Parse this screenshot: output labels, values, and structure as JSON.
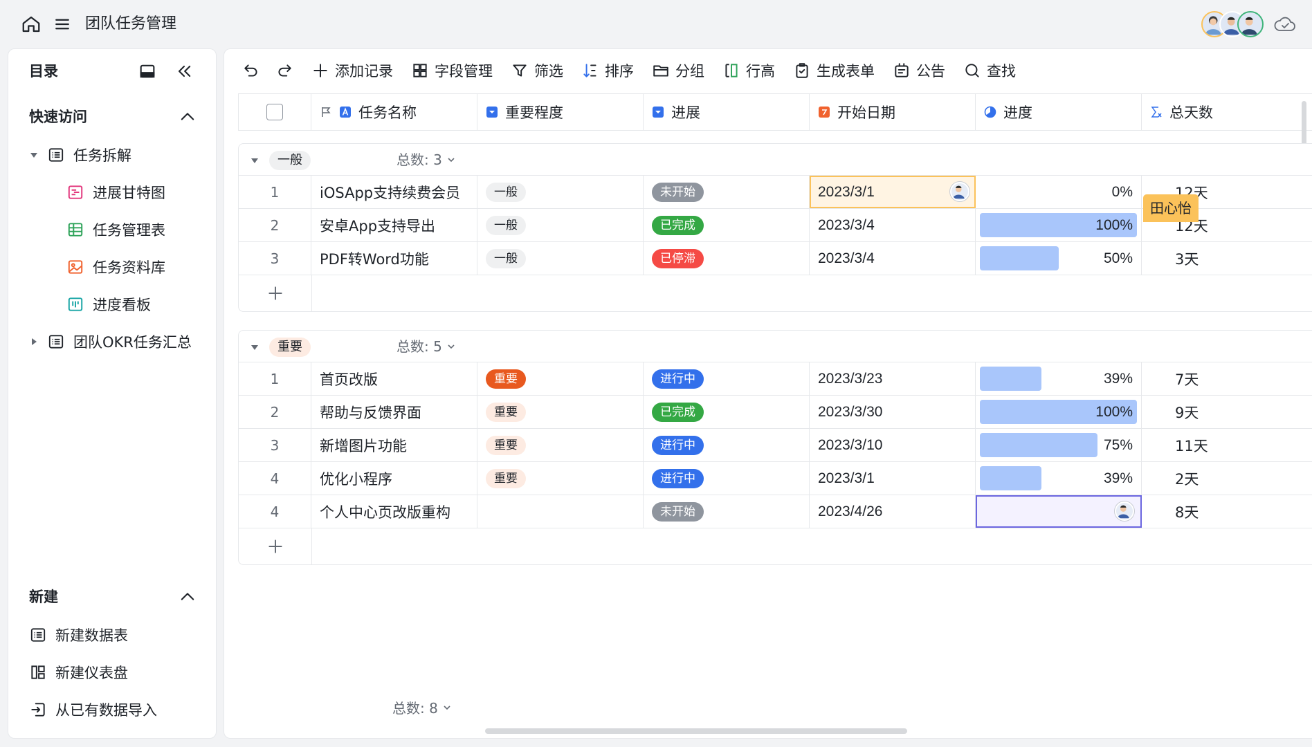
{
  "app": {
    "title": "团队任务管理"
  },
  "sidebar": {
    "title": "目录",
    "quick_access": {
      "label": "快速访问",
      "items": [
        {
          "label": "任务拆解",
          "icon": "table-icon"
        },
        {
          "label": "进展甘特图",
          "icon": "gantt-icon"
        },
        {
          "label": "任务管理表",
          "icon": "grid-icon"
        },
        {
          "label": "任务资料库",
          "icon": "gallery-icon"
        },
        {
          "label": "进度看板",
          "icon": "kanban-icon"
        },
        {
          "label": "团队OKR任务汇总",
          "icon": "table-icon"
        }
      ]
    },
    "create": {
      "label": "新建",
      "items": [
        {
          "label": "新建数据表",
          "icon": "table-icon"
        },
        {
          "label": "新建仪表盘",
          "icon": "dashboard-icon"
        },
        {
          "label": "从已有数据导入",
          "icon": "import-icon"
        }
      ]
    }
  },
  "toolbar": {
    "add_record": "添加记录",
    "field_manage": "字段管理",
    "filter": "筛选",
    "sort": "排序",
    "group": "分组",
    "row_height": "行高",
    "form": "生成表单",
    "notice": "公告",
    "find": "查找"
  },
  "columns": {
    "name": "任务名称",
    "importance": "重要程度",
    "status": "进展",
    "start_date": "开始日期",
    "progress": "进度",
    "total_days": "总天数"
  },
  "groups": [
    {
      "tag": "一般",
      "count_label": "总数: 3",
      "rows": [
        {
          "num": "1",
          "name": "iOSApp支持续费会员",
          "importance": "一般",
          "status": "未开始",
          "date": "2023/3/1",
          "progress": 0,
          "progress_label": "0%",
          "days": "12天"
        },
        {
          "num": "2",
          "name": "安卓App支持导出",
          "importance": "一般",
          "status": "已完成",
          "date": "2023/3/4",
          "progress": 100,
          "progress_label": "100%",
          "days": "12天"
        },
        {
          "num": "3",
          "name": "PDF转Word功能",
          "importance": "一般",
          "status": "已停滞",
          "date": "2023/3/4",
          "progress": 50,
          "progress_label": "50%",
          "days": "3天"
        }
      ]
    },
    {
      "tag": "重要",
      "count_label": "总数: 5",
      "rows": [
        {
          "num": "1",
          "name": "首页改版",
          "importance": "重要",
          "status": "进行中",
          "date": "2023/3/23",
          "progress": 39,
          "progress_label": "39%",
          "days": "7天"
        },
        {
          "num": "2",
          "name": "帮助与反馈界面",
          "importance": "重要",
          "status": "已完成",
          "date": "2023/3/30",
          "progress": 100,
          "progress_label": "100%",
          "days": "9天"
        },
        {
          "num": "3",
          "name": "新增图片功能",
          "importance": "重要",
          "status": "进行中",
          "date": "2023/3/10",
          "progress": 75,
          "progress_label": "75%",
          "days": "11天"
        },
        {
          "num": "4",
          "name": "优化小程序",
          "importance": "重要",
          "status": "进行中",
          "date": "2023/3/1",
          "progress": 39,
          "progress_label": "39%",
          "days": "2天"
        },
        {
          "num": "4",
          "name": "个人中心页改版重构",
          "importance": "",
          "status": "未开始",
          "date": "2023/4/26",
          "progress": null,
          "progress_label": "",
          "days": "8天"
        }
      ]
    }
  ],
  "collaborator": {
    "name": "田心怡"
  },
  "footer": {
    "count_label": "总数: 8"
  },
  "colors": {
    "accent": "#3370eb",
    "progress_fill": "#a9c6fb",
    "collab": "#fbc25a",
    "important": "#e8591f"
  }
}
